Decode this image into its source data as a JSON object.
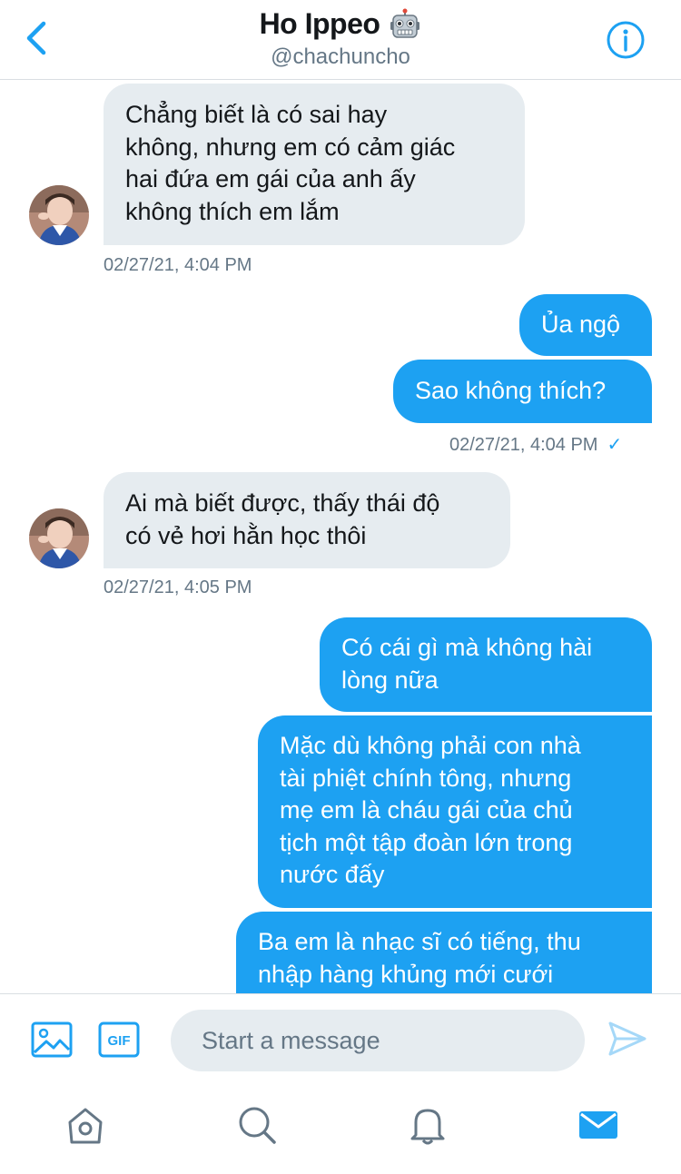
{
  "header": {
    "title": "Ho Ippeo",
    "handle": "@chachuncho"
  },
  "icons": {
    "back": "chevron-left-icon",
    "info": "info-icon",
    "title_badge": "robot-emoji-icon",
    "media": "image-icon",
    "gif": "gif-icon",
    "send": "send-icon",
    "tabs": [
      "home-icon",
      "search-icon",
      "notifications-icon",
      "messages-icon"
    ]
  },
  "colors": {
    "accent": "#1da1f2",
    "incoming_bubble": "#e6ecf0",
    "secondary_text": "#657786"
  },
  "messages": [
    {
      "side": "in",
      "lines": [
        "Chẳng biết là có sai hay",
        "không, nhưng em có cảm giác",
        "hai đứa em gái của anh ấy",
        "không thích em lắm"
      ],
      "timestamp": "02/27/21, 4:04 PM"
    },
    {
      "side": "out",
      "lines": [
        "Ủa ngộ"
      ]
    },
    {
      "side": "out",
      "lines": [
        "Sao không thích?"
      ],
      "timestamp": "02/27/21, 4:04 PM",
      "status": "✓"
    },
    {
      "side": "in",
      "lines": [
        "Ai mà biết được, thấy thái độ",
        "có vẻ hơi hằn học thôi"
      ],
      "timestamp": "02/27/21, 4:05 PM"
    },
    {
      "side": "out",
      "lines": [
        "Có cái gì mà không hài",
        "lòng nữa"
      ]
    },
    {
      "side": "out",
      "lines": [
        "Mặc dù không phải con nhà",
        "tài phiệt chính tông, nhưng",
        "mẹ em là cháu gái của chủ",
        "tịch một tập đoàn lớn trong",
        "nước đấy"
      ]
    },
    {
      "side": "out",
      "lines": [
        "Ba em là nhạc sĩ có tiếng, thu",
        "nhập hàng khủng mới cưới"
      ]
    }
  ],
  "composer": {
    "placeholder": "Start a message",
    "gif_label": "GIF"
  }
}
